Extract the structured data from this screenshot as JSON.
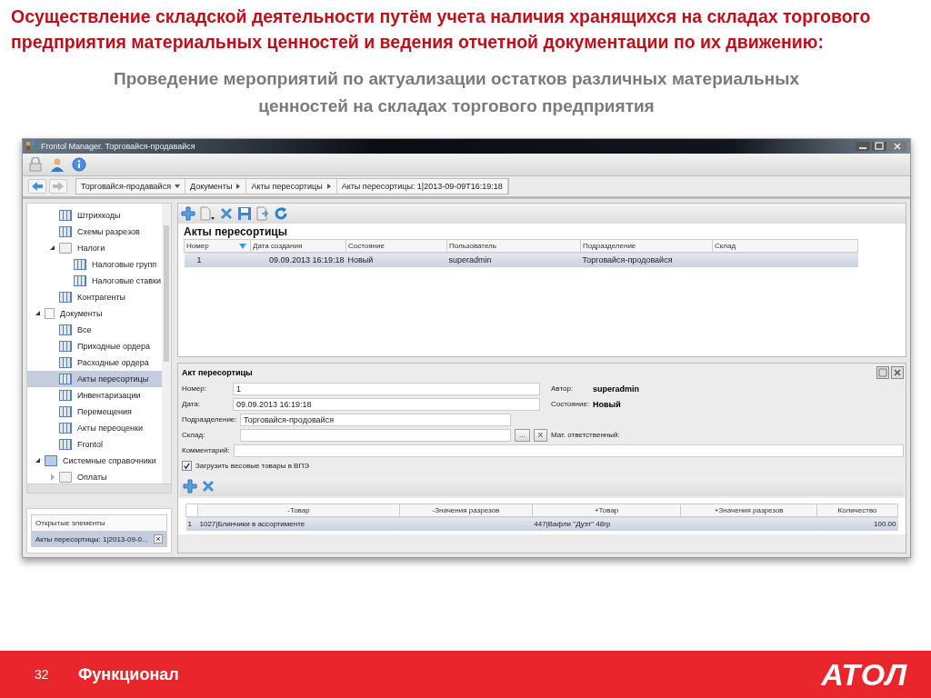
{
  "slide": {
    "title": "Осуществление складской деятельности путём учета наличия хранящихся на складах торгового предприятия материальных ценностей и ведения отчетной документации по их движению:",
    "subtitle": "Проведение мероприятий по актуализации остатков различных материальных ценностей на складах торгового предприятия",
    "page_number": "32",
    "footer_label": "Функционал",
    "logo": "АТОЛ"
  },
  "window": {
    "title": "Frontol Manager. Торговайся-продавайся",
    "breadcrumbs": [
      {
        "label": "Торговайся-продавайся",
        "kind": "dropdown"
      },
      {
        "label": "Документы",
        "kind": "arrow"
      },
      {
        "label": "Акты пересортицы",
        "kind": "arrow"
      },
      {
        "label": "Акты пересортицы: 1|2013-09-09T16:19:18",
        "kind": "plain"
      }
    ],
    "tree": {
      "scrolled_branch": [
        {
          "label": "Штрихкоды",
          "kind": "table",
          "selected": false
        },
        {
          "label": "Схемы разрезов",
          "kind": "table",
          "selected": false
        },
        {
          "label": "Налоги",
          "kind": "folder",
          "selected": false,
          "expanded": true,
          "children": [
            {
              "label": "Налоговые групп",
              "kind": "table",
              "selected": false
            },
            {
              "label": "Налоговые ставки",
              "kind": "table",
              "selected": false
            }
          ]
        },
        {
          "label": "Контрагенты",
          "kind": "table",
          "selected": false
        }
      ],
      "items": [
        {
          "label": "Документы",
          "kind": "doc",
          "selected": false,
          "expanded": true,
          "children": [
            {
              "label": "Все",
              "kind": "table",
              "selected": false
            },
            {
              "label": "Приходные ордера",
              "kind": "table",
              "selected": false
            },
            {
              "label": "Расходные ордера",
              "kind": "table",
              "selected": false
            },
            {
              "label": "Акты пересортицы",
              "kind": "table",
              "selected": true
            },
            {
              "label": "Инвентаризации",
              "kind": "table",
              "selected": false
            },
            {
              "label": "Перемещения",
              "kind": "table",
              "selected": false
            },
            {
              "label": "Акты переоценки",
              "kind": "table",
              "selected": false
            },
            {
              "label": "Frontol",
              "kind": "table",
              "selected": false
            }
          ]
        },
        {
          "label": "Системные справочники",
          "kind": "sys",
          "selected": false,
          "expanded": true,
          "children": [
            {
              "label": "Оплаты",
              "kind": "folder",
              "selected": false,
              "expanded": false
            }
          ]
        }
      ]
    },
    "open_elements": {
      "header": "Открытые элементы",
      "items": [
        {
          "label": "Акты пересортицы: 1|2013-09-0...",
          "selected": true
        }
      ]
    },
    "list": {
      "title": "Акты пересортицы",
      "columns": [
        "Номер",
        "Дата создания",
        "Состояние",
        "Пользователь",
        "Подразделение",
        "Склад"
      ],
      "rows": [
        {
          "cells": [
            "1",
            "09.09.2013 16:19:18",
            "Новый",
            "superadmin",
            "Торговайся-продовайся",
            ""
          ],
          "selected": true
        }
      ]
    },
    "detail": {
      "title": "Акт пересортицы",
      "number_label": "Номер:",
      "number": "1",
      "author_label": "Автор:",
      "author": "superadmin",
      "date_label": "Дата:",
      "date": "09.09.2013 16:19:18",
      "state_label": "Состояние:",
      "state": "Новый",
      "division_label": "Подразделение:",
      "division": "Торговайся-продовайся",
      "warehouse_label": "Склад:",
      "browse_button": "...",
      "clear_button": "X",
      "responsible_label": "Мат. ответственный:",
      "comment_label": "Комментарий:",
      "checkbox": {
        "label": "Загрузить весовые товары в ВПЭ",
        "checked": true
      }
    },
    "lines": {
      "columns": [
        "-Товар",
        "-Значения разрезов",
        "+Товар",
        "+Значения разрезов",
        "Количество"
      ],
      "rows": [
        {
          "index": "1",
          "cells": [
            "1027|Блинчики в ассортименте",
            "",
            "447|Вафли \"Дуэт\" 48гр",
            "",
            "100.00"
          ],
          "selected": true
        }
      ]
    }
  }
}
